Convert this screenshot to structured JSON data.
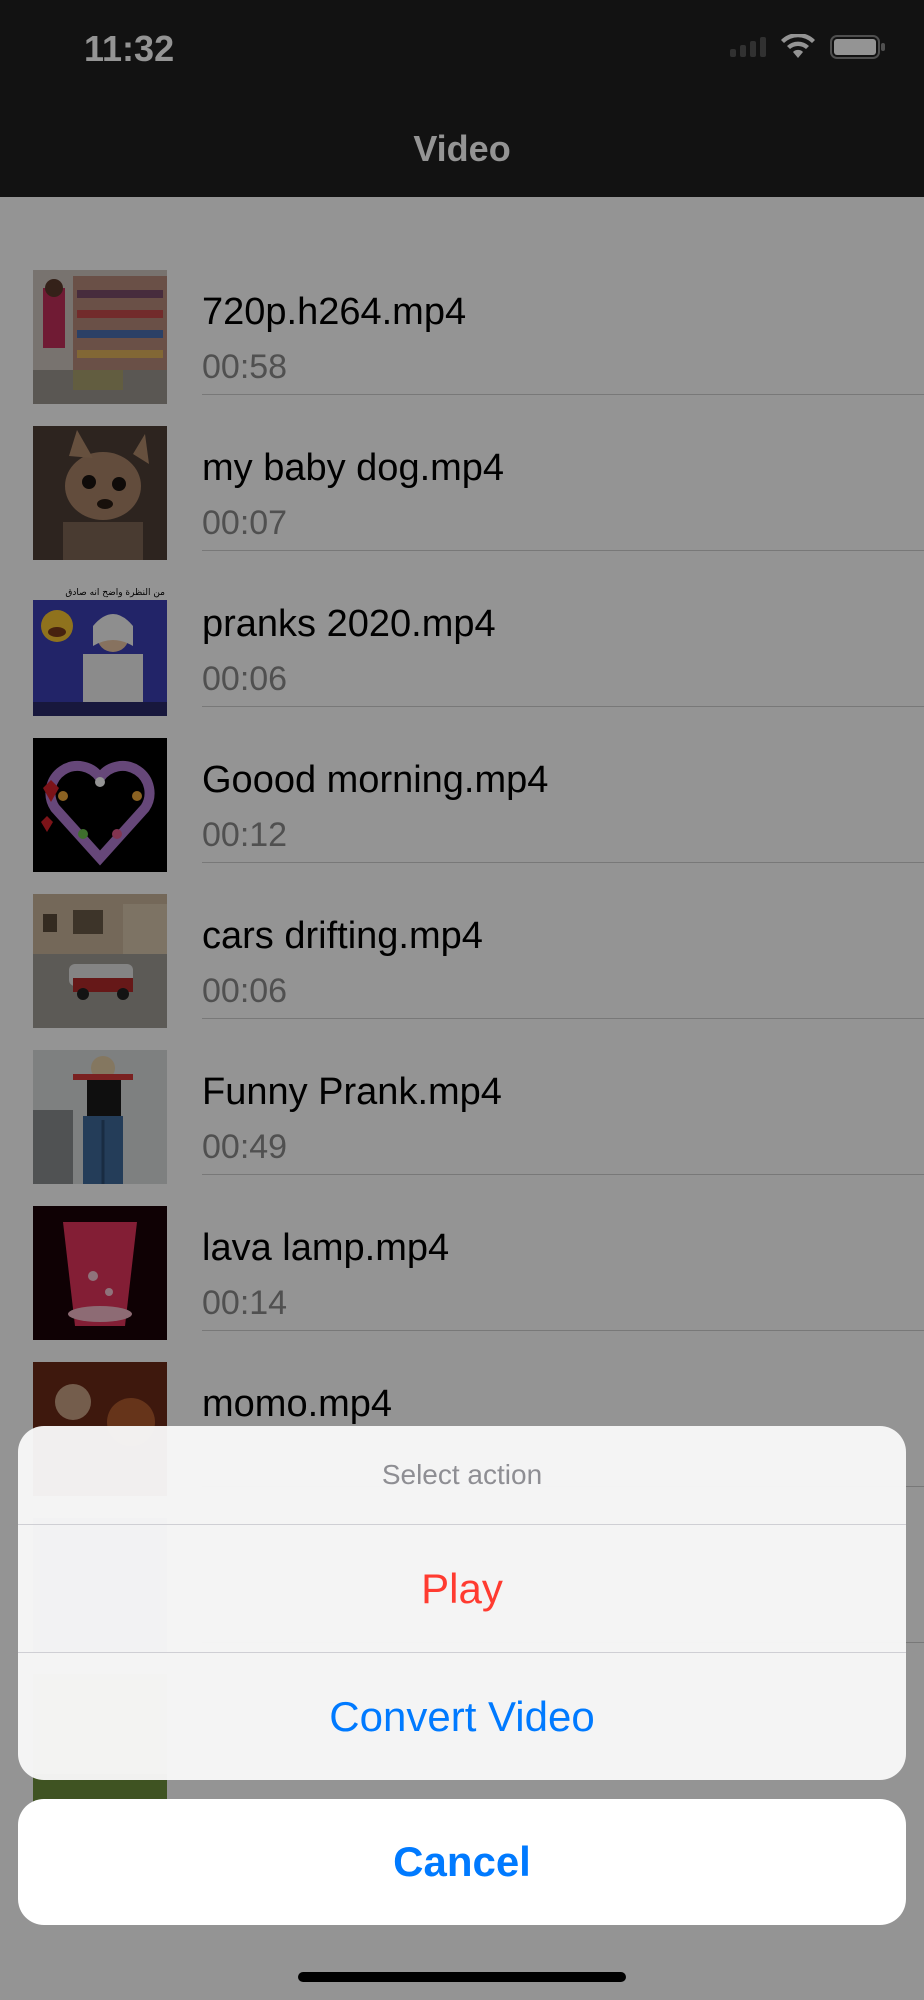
{
  "status_bar": {
    "time": "11:32"
  },
  "nav": {
    "title": "Video"
  },
  "videos": [
    {
      "title": "720p.h264.mp4",
      "duration": "00:58"
    },
    {
      "title": "my baby dog.mp4",
      "duration": "00:07"
    },
    {
      "title": "pranks 2020.mp4",
      "duration": "00:06"
    },
    {
      "title": "Goood morning.mp4",
      "duration": "00:12"
    },
    {
      "title": "cars drifting.mp4",
      "duration": "00:06"
    },
    {
      "title": "Funny Prank.mp4",
      "duration": "00:49"
    },
    {
      "title": "lava lamp.mp4",
      "duration": "00:14"
    },
    {
      "title": "momo.mp4",
      "duration": ""
    }
  ],
  "thumb_overlay": {
    "caption_ar": "من النظرة واضح انه صادق"
  },
  "action_sheet": {
    "title": "Select action",
    "play_label": "Play",
    "convert_label": "Convert Video",
    "cancel_label": "Cancel"
  },
  "colors": {
    "destructive": "#ff3b30",
    "accent": "#007aff"
  }
}
